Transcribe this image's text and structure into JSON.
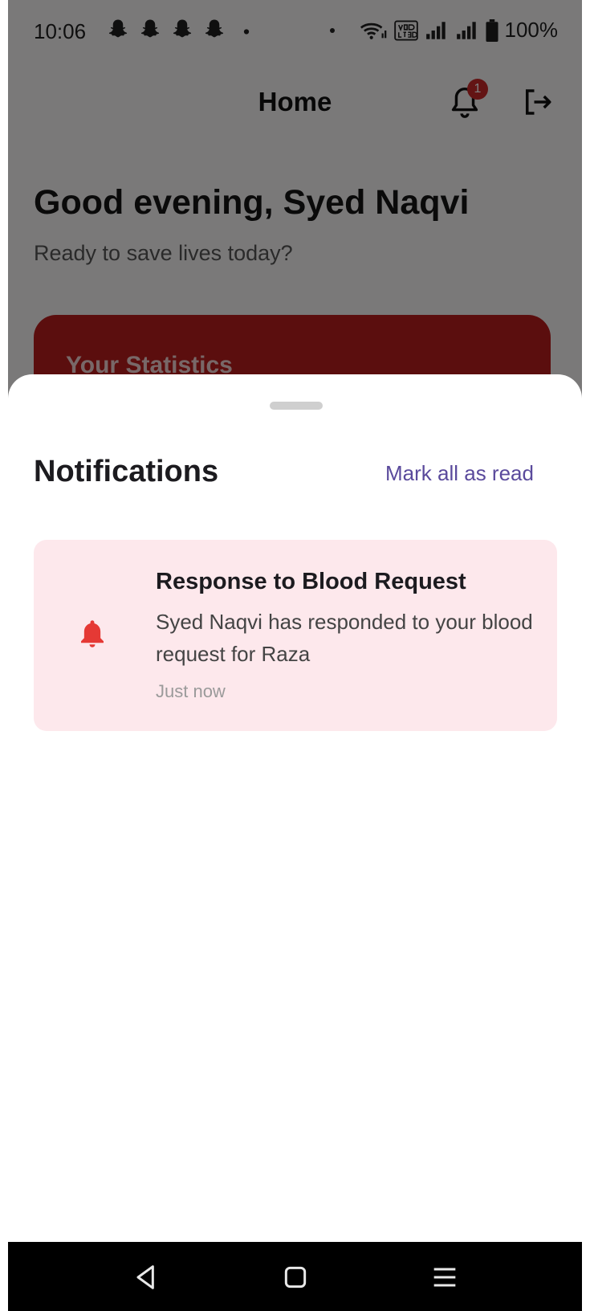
{
  "status_bar": {
    "time": "10:06",
    "battery": "100%",
    "notification_icons": [
      "snapchat-icon",
      "snapchat-icon",
      "snapchat-icon",
      "snapchat-icon"
    ],
    "right_icons": [
      "wifi-icon",
      "volte-icon",
      "signal-icon",
      "signal-icon",
      "battery-icon"
    ]
  },
  "app_bar": {
    "title": "Home",
    "notification_count": "1"
  },
  "home": {
    "greeting": "Good evening, Syed Naqvi",
    "subgreeting": "Ready to save lives today?",
    "stats_title": "Your Statistics"
  },
  "sheet": {
    "title": "Notifications",
    "mark_all_label": "Mark all as read",
    "notifications": [
      {
        "title": "Response to Blood Request",
        "body": "Syed Naqvi has responded to your blood request for Raza",
        "time": "Just now"
      }
    ]
  },
  "colors": {
    "primary": "#b71c1c",
    "accent_link": "#5a4a9c",
    "card_background": "#fde8ec",
    "bell_icon": "#e53935"
  }
}
